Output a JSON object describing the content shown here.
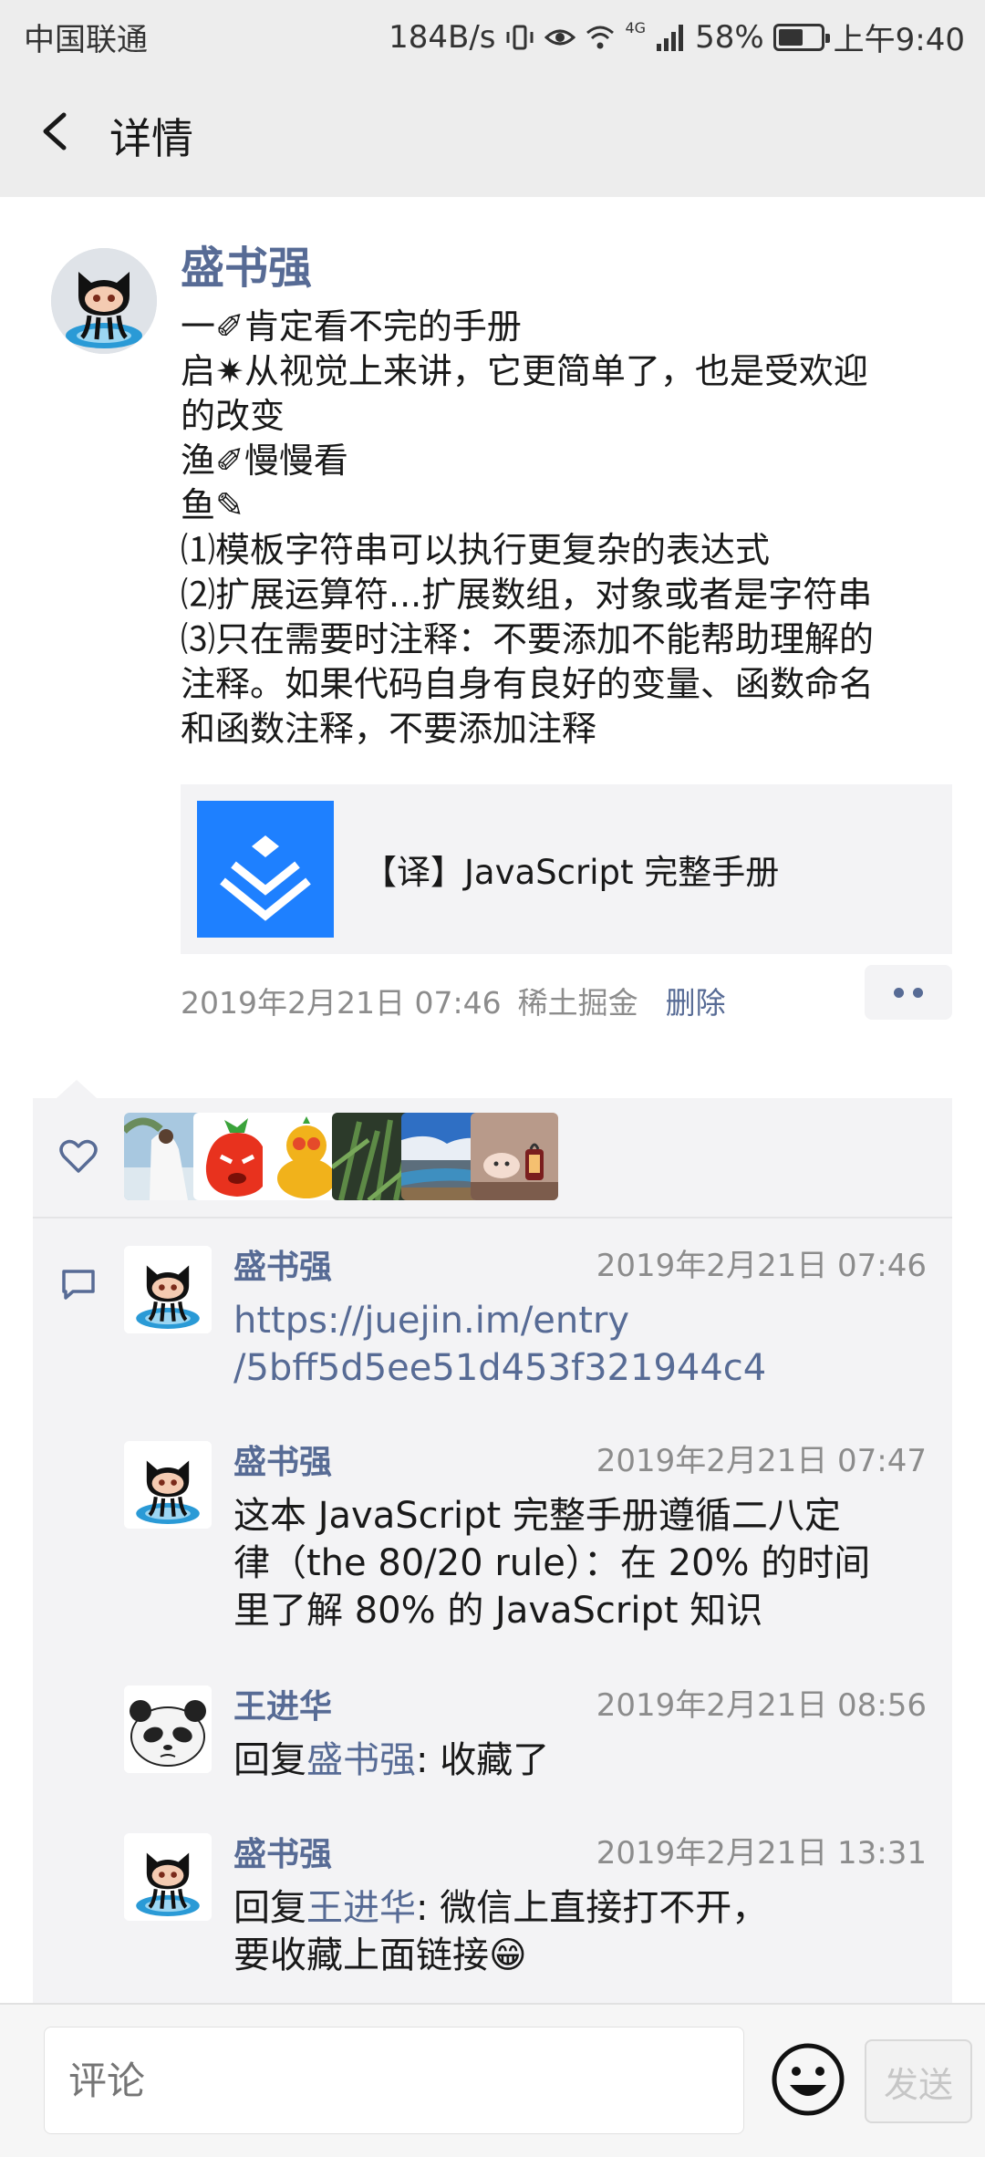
{
  "status_bar": {
    "carrier": "中国联通",
    "speed": "184B/s",
    "network": "4G",
    "battery": "58%",
    "battery_level": 0.58,
    "time": "上午9:40"
  },
  "nav": {
    "back_icon": "chevron-left-icon",
    "title": "详情"
  },
  "moment": {
    "author": "盛书强",
    "lines": [
      "一✐肯定看不完的手册",
      "启✷从视觉上来讲，它更简单了，也是受欢迎",
      "的改变",
      "渔✐慢慢看",
      "鱼✎",
      "⑴模板字符串可以执行更复杂的表达式",
      "⑵扩展运算符...扩展数组，对象或者是字符串",
      "⑶只在需要时注释：不要添加不能帮助理解的",
      "注释。如果代码自身有良好的变量、函数命名",
      "和函数注释，不要添加注释"
    ],
    "link_card": {
      "title": "【译】JavaScript 完整手册",
      "thumb_color": "#1e80ff",
      "thumb_icon": "juejin-logo-icon"
    },
    "date": "2019年2月21日 07:46",
    "source": "稀土掘金",
    "delete_label": "删除"
  },
  "likes": {
    "icon": "heart-icon",
    "count": 6
  },
  "comments": [
    {
      "name": "盛书强",
      "time": "2019年2月21日 07:46",
      "lines": [
        "https://juejin.im/entry",
        "/5bff5d5ee51d453f321944c4"
      ]
    },
    {
      "name": "盛书强",
      "time": "2019年2月21日 07:47",
      "lines": [
        "这本 JavaScript 完整手册遵循二八定",
        "律（the 80/20 rule）：在 20% 的时间",
        "里了解 80% 的 JavaScript 知识"
      ]
    },
    {
      "name": "王进华",
      "time": "2019年2月21日 08:56",
      "reply_prefix": "回复",
      "reply_to": "盛书强",
      "reply_text": ": 收藏了"
    },
    {
      "name": "盛书强",
      "time": "2019年2月21日 13:31",
      "reply_prefix": "回复",
      "reply_to": "王进华",
      "reply_text": ": 微信上直接打不开，",
      "line2": "要收藏上面链接😁"
    }
  ],
  "input": {
    "placeholder": "评论",
    "send_label": "发送"
  },
  "colors": {
    "link_blue": "#576b95",
    "panel_bg": "#f3f3f5",
    "nav_bg": "#ededed"
  }
}
